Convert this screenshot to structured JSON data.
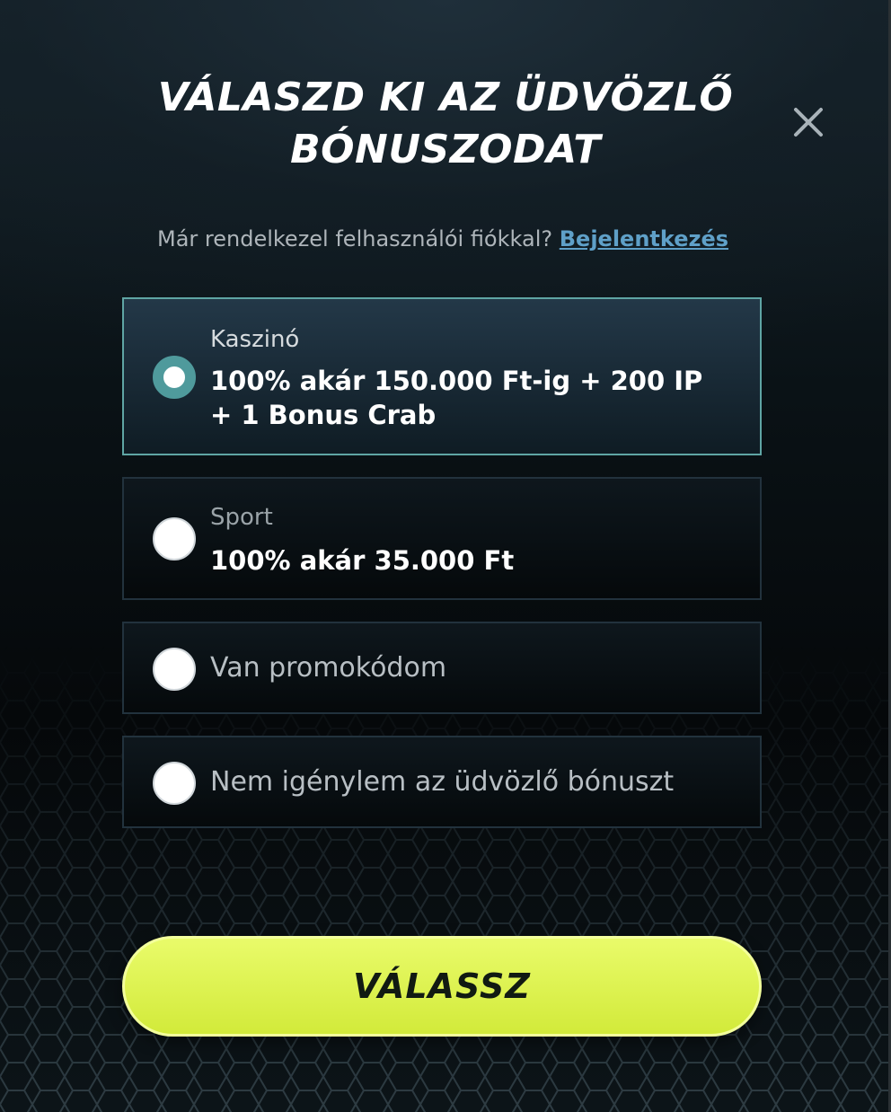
{
  "modal": {
    "title_line1": "VÁLASZD KI AZ ÜDVÖZLŐ",
    "title_line2": "BÓNUSZODAT",
    "close_icon": "close-icon"
  },
  "login": {
    "prompt": "Már rendelkezel felhasználói fiókkal?",
    "link_label": "Bejelentkezés"
  },
  "options": [
    {
      "label": "Kaszinó",
      "value": "100% akár 150.000 Ft-ig + 200 IP + 1 Bonus Crab",
      "selected": true
    },
    {
      "label": "Sport",
      "value": "100% akár 35.000 Ft",
      "selected": false
    },
    {
      "label": "Van promokódom",
      "selected": false
    },
    {
      "label": "Nem igénylem az üdvözlő bónuszt",
      "selected": false
    }
  ],
  "cta": {
    "label": "VÁLASSZ"
  },
  "colors": {
    "accent_teal": "#4f9a9c",
    "link_blue": "#5fa0c8",
    "cta_lime": "#dff24e",
    "background": "#0b1013"
  }
}
